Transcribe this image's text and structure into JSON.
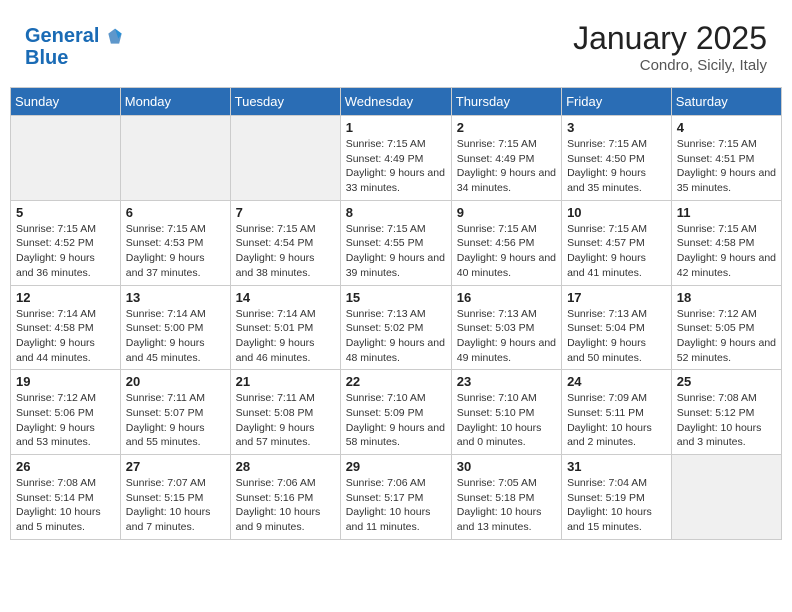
{
  "header": {
    "logo_line1": "General",
    "logo_line2": "Blue",
    "month": "January 2025",
    "location": "Condro, Sicily, Italy"
  },
  "weekdays": [
    "Sunday",
    "Monday",
    "Tuesday",
    "Wednesday",
    "Thursday",
    "Friday",
    "Saturday"
  ],
  "weeks": [
    [
      {
        "day": "",
        "info": ""
      },
      {
        "day": "",
        "info": ""
      },
      {
        "day": "",
        "info": ""
      },
      {
        "day": "1",
        "info": "Sunrise: 7:15 AM\nSunset: 4:49 PM\nDaylight: 9 hours\nand 33 minutes."
      },
      {
        "day": "2",
        "info": "Sunrise: 7:15 AM\nSunset: 4:49 PM\nDaylight: 9 hours\nand 34 minutes."
      },
      {
        "day": "3",
        "info": "Sunrise: 7:15 AM\nSunset: 4:50 PM\nDaylight: 9 hours\nand 35 minutes."
      },
      {
        "day": "4",
        "info": "Sunrise: 7:15 AM\nSunset: 4:51 PM\nDaylight: 9 hours\nand 35 minutes."
      }
    ],
    [
      {
        "day": "5",
        "info": "Sunrise: 7:15 AM\nSunset: 4:52 PM\nDaylight: 9 hours\nand 36 minutes."
      },
      {
        "day": "6",
        "info": "Sunrise: 7:15 AM\nSunset: 4:53 PM\nDaylight: 9 hours\nand 37 minutes."
      },
      {
        "day": "7",
        "info": "Sunrise: 7:15 AM\nSunset: 4:54 PM\nDaylight: 9 hours\nand 38 minutes."
      },
      {
        "day": "8",
        "info": "Sunrise: 7:15 AM\nSunset: 4:55 PM\nDaylight: 9 hours\nand 39 minutes."
      },
      {
        "day": "9",
        "info": "Sunrise: 7:15 AM\nSunset: 4:56 PM\nDaylight: 9 hours\nand 40 minutes."
      },
      {
        "day": "10",
        "info": "Sunrise: 7:15 AM\nSunset: 4:57 PM\nDaylight: 9 hours\nand 41 minutes."
      },
      {
        "day": "11",
        "info": "Sunrise: 7:15 AM\nSunset: 4:58 PM\nDaylight: 9 hours\nand 42 minutes."
      }
    ],
    [
      {
        "day": "12",
        "info": "Sunrise: 7:14 AM\nSunset: 4:58 PM\nDaylight: 9 hours\nand 44 minutes."
      },
      {
        "day": "13",
        "info": "Sunrise: 7:14 AM\nSunset: 5:00 PM\nDaylight: 9 hours\nand 45 minutes."
      },
      {
        "day": "14",
        "info": "Sunrise: 7:14 AM\nSunset: 5:01 PM\nDaylight: 9 hours\nand 46 minutes."
      },
      {
        "day": "15",
        "info": "Sunrise: 7:13 AM\nSunset: 5:02 PM\nDaylight: 9 hours\nand 48 minutes."
      },
      {
        "day": "16",
        "info": "Sunrise: 7:13 AM\nSunset: 5:03 PM\nDaylight: 9 hours\nand 49 minutes."
      },
      {
        "day": "17",
        "info": "Sunrise: 7:13 AM\nSunset: 5:04 PM\nDaylight: 9 hours\nand 50 minutes."
      },
      {
        "day": "18",
        "info": "Sunrise: 7:12 AM\nSunset: 5:05 PM\nDaylight: 9 hours\nand 52 minutes."
      }
    ],
    [
      {
        "day": "19",
        "info": "Sunrise: 7:12 AM\nSunset: 5:06 PM\nDaylight: 9 hours\nand 53 minutes."
      },
      {
        "day": "20",
        "info": "Sunrise: 7:11 AM\nSunset: 5:07 PM\nDaylight: 9 hours\nand 55 minutes."
      },
      {
        "day": "21",
        "info": "Sunrise: 7:11 AM\nSunset: 5:08 PM\nDaylight: 9 hours\nand 57 minutes."
      },
      {
        "day": "22",
        "info": "Sunrise: 7:10 AM\nSunset: 5:09 PM\nDaylight: 9 hours\nand 58 minutes."
      },
      {
        "day": "23",
        "info": "Sunrise: 7:10 AM\nSunset: 5:10 PM\nDaylight: 10 hours\nand 0 minutes."
      },
      {
        "day": "24",
        "info": "Sunrise: 7:09 AM\nSunset: 5:11 PM\nDaylight: 10 hours\nand 2 minutes."
      },
      {
        "day": "25",
        "info": "Sunrise: 7:08 AM\nSunset: 5:12 PM\nDaylight: 10 hours\nand 3 minutes."
      }
    ],
    [
      {
        "day": "26",
        "info": "Sunrise: 7:08 AM\nSunset: 5:14 PM\nDaylight: 10 hours\nand 5 minutes."
      },
      {
        "day": "27",
        "info": "Sunrise: 7:07 AM\nSunset: 5:15 PM\nDaylight: 10 hours\nand 7 minutes."
      },
      {
        "day": "28",
        "info": "Sunrise: 7:06 AM\nSunset: 5:16 PM\nDaylight: 10 hours\nand 9 minutes."
      },
      {
        "day": "29",
        "info": "Sunrise: 7:06 AM\nSunset: 5:17 PM\nDaylight: 10 hours\nand 11 minutes."
      },
      {
        "day": "30",
        "info": "Sunrise: 7:05 AM\nSunset: 5:18 PM\nDaylight: 10 hours\nand 13 minutes."
      },
      {
        "day": "31",
        "info": "Sunrise: 7:04 AM\nSunset: 5:19 PM\nDaylight: 10 hours\nand 15 minutes."
      },
      {
        "day": "",
        "info": ""
      }
    ]
  ]
}
